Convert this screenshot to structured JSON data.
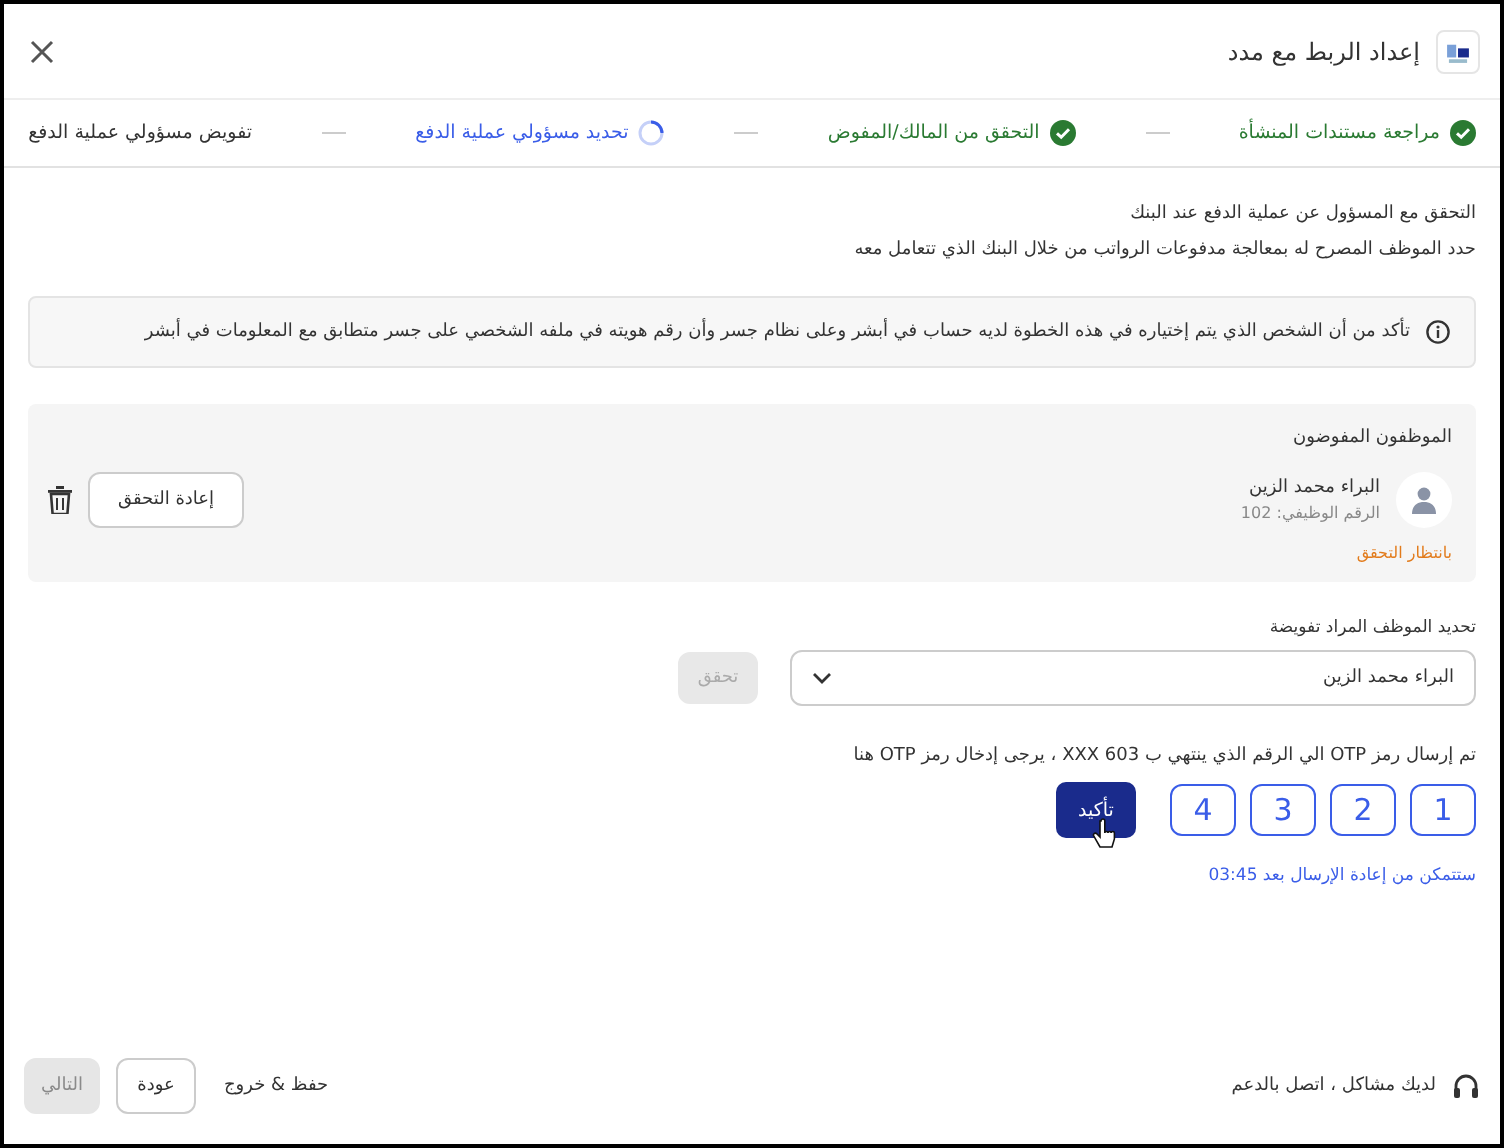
{
  "window": {
    "title": "إعداد الربط مع مدد"
  },
  "steps": [
    {
      "label": "مراجعة مستندات المنشأة",
      "completed": true,
      "selected": false
    },
    {
      "label": "التحقق من المالك/المفوض",
      "completed": true,
      "selected": false
    },
    {
      "label": "تحديد مسؤولي عملية الدفع",
      "completed": false,
      "selected": true
    },
    {
      "label": "تفويض مسؤولي عملية الدفع",
      "completed": false,
      "selected": false
    }
  ],
  "intro": {
    "title": "التحقق مع المسؤول عن عملية الدفع عند البنك",
    "description": "حدد الموظف المصرح له بمعالجة مدفوعات الرواتب من خلال البنك الذي تتعامل معه"
  },
  "notice": "تأكد من أن الشخص الذي يتم إختياره في هذه الخطوة لديه حساب في أبشر وعلى نظام جسر وأن رقم هويته في ملفه الشخصي على جسر متطابق مع المعلومات في أبشر",
  "authorized": {
    "title": "الموظفون المفوضون",
    "employees": [
      {
        "name": "البراء محمد الزين",
        "employee_id": "الرقم الوظيفي: 102",
        "status": "بانتظار التحقق",
        "action": "إعادة التحقق"
      }
    ]
  },
  "select": {
    "label": "تحديد الموظف المراد تفويضة",
    "value": "البراء محمد الزين",
    "button": {
      "label": "تحقق",
      "disabled": true
    }
  },
  "otp": {
    "message": "تم إرسال رمز OTP الي الرقم الذي ينتهي ب XXX 603 ، يرجى إدخال رمز OTP هنا",
    "digits": [
      "1",
      "2",
      "3",
      "4"
    ],
    "confirm": "تأكيد",
    "resend": "ستتمكن من إعادة الإرسال بعد 03:45"
  },
  "footer": {
    "support": "لديك مشاكل ، اتصل بالدعم",
    "save_exit": "حفظ & خروج",
    "back": "عودة",
    "next": {
      "label": "التالي",
      "disabled": true
    }
  }
}
